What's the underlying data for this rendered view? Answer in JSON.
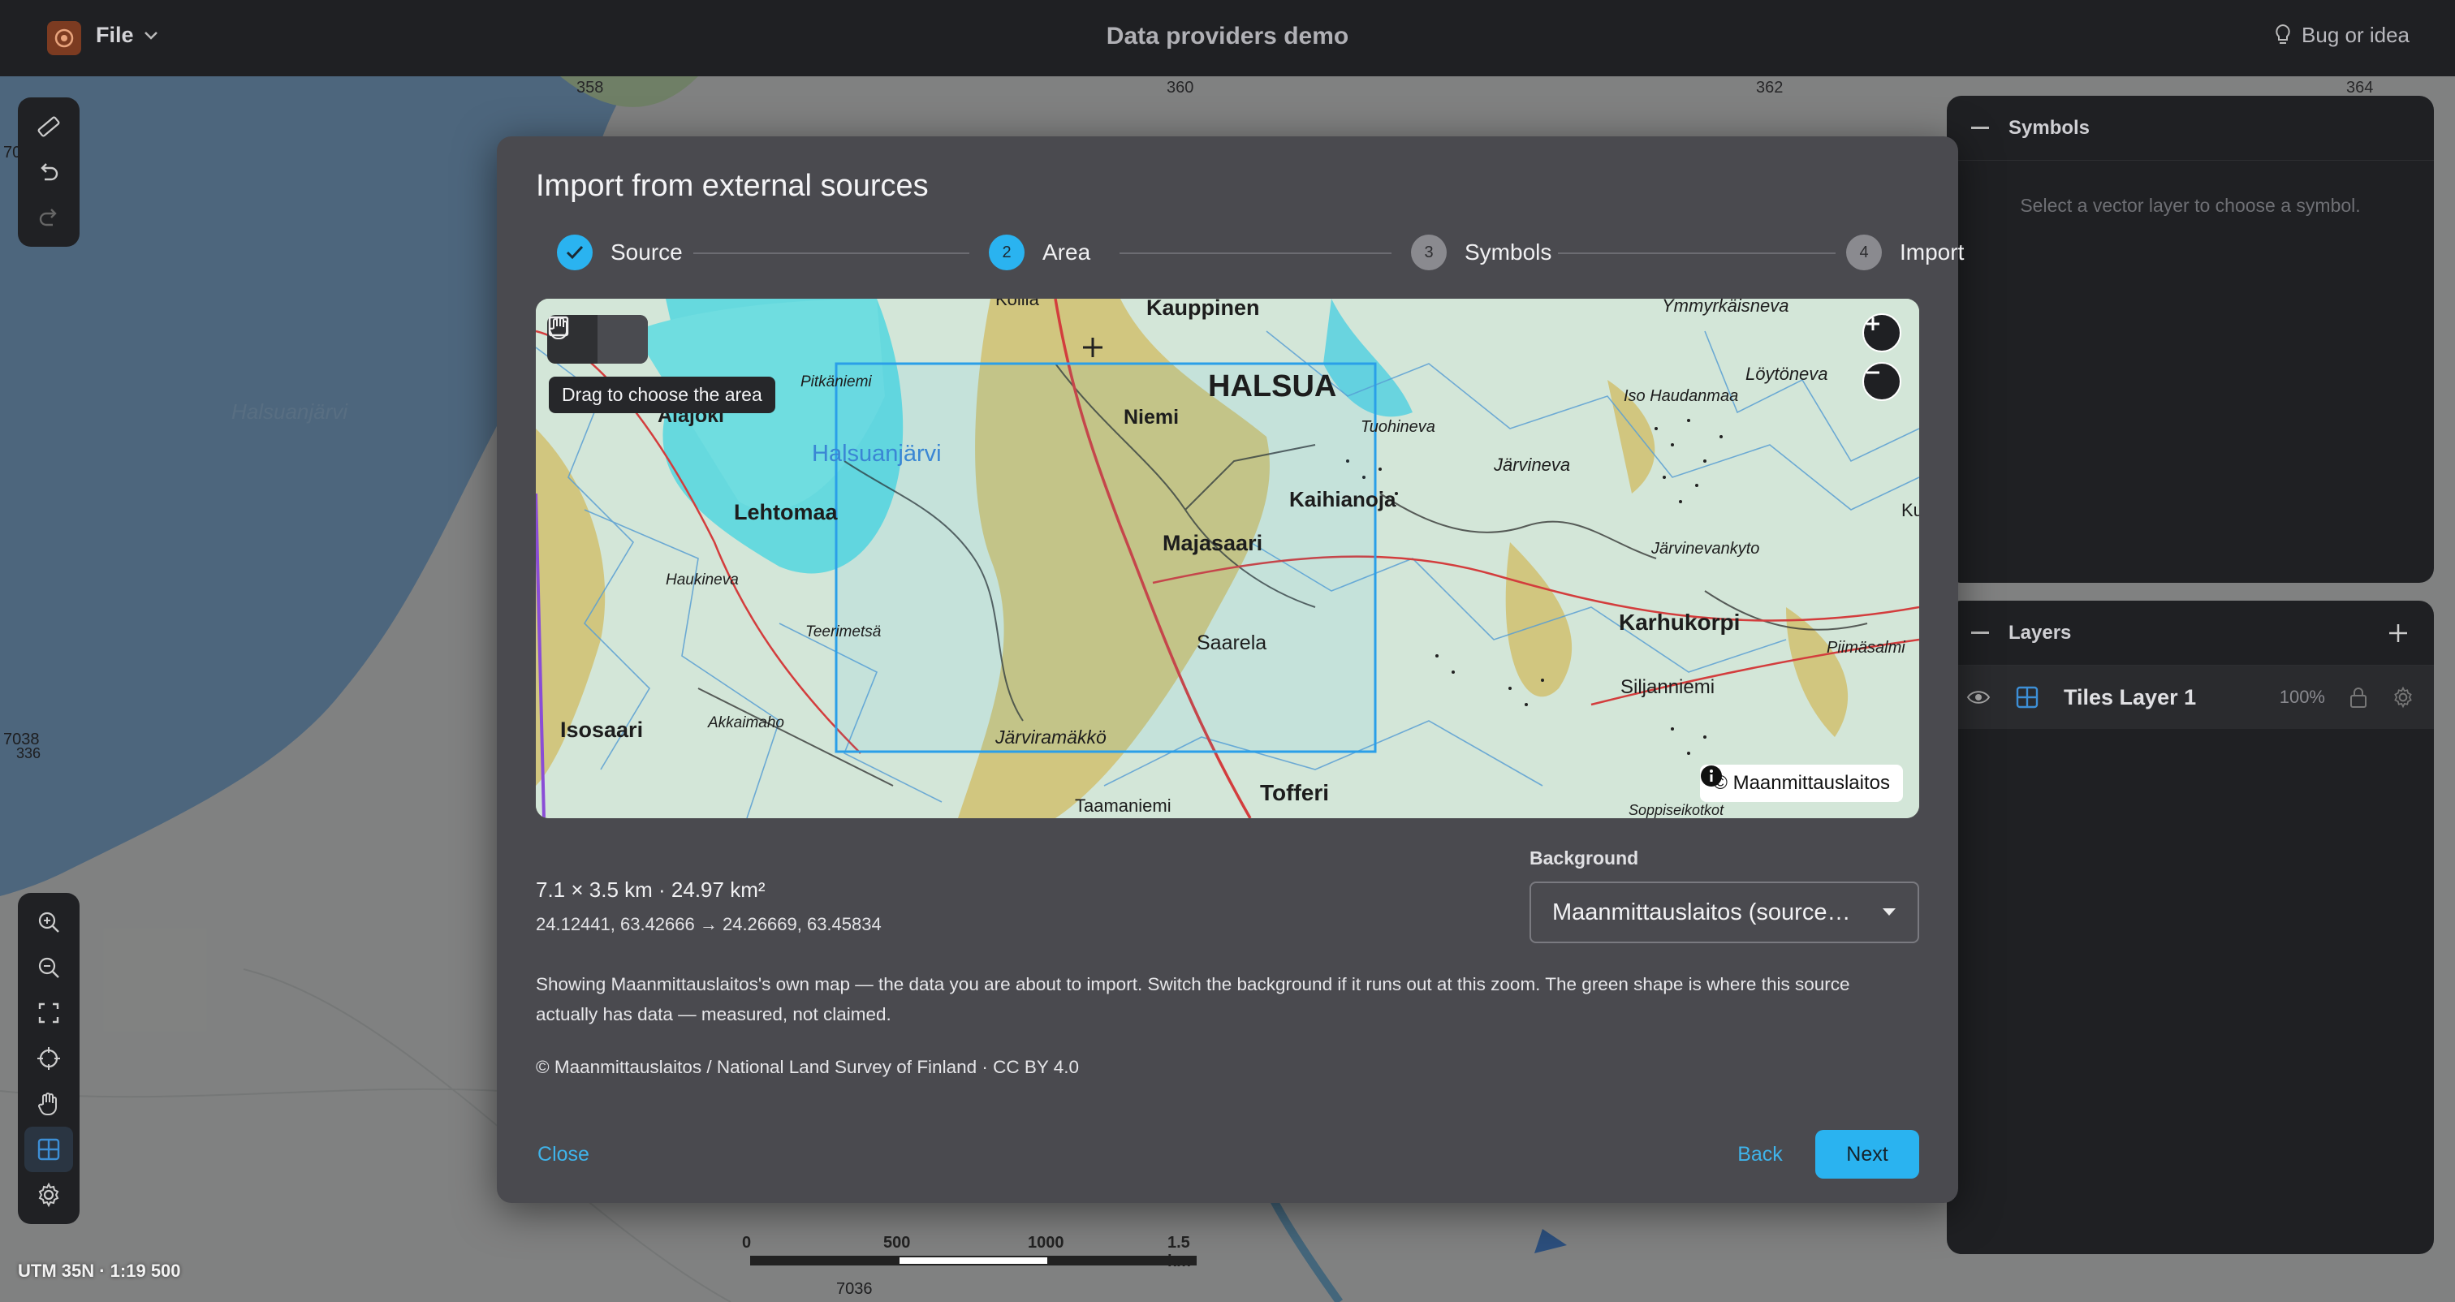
{
  "app": {
    "file_menu": "File",
    "title": "Data providers demo",
    "bug_link": "Bug or idea"
  },
  "background_map": {
    "lake_label": "Halsuanjärvi",
    "grid_labels_top": [
      "358",
      "360",
      "362",
      "364"
    ],
    "grid_label_left": "7038",
    "grid_label_left_small": "336",
    "grid_label_left_top": "70",
    "grid_label_bottom": "7036"
  },
  "status": {
    "projection": "UTM 35N · 1:19 500"
  },
  "scale_bar": {
    "ticks": [
      "0",
      "500",
      "1000",
      "1.5 km"
    ]
  },
  "symbols_panel": {
    "title": "Symbols",
    "placeholder": "Select a vector layer to choose a symbol."
  },
  "layers_panel": {
    "title": "Layers",
    "layers": [
      {
        "name": "Tiles Layer 1",
        "opacity": "100%"
      }
    ]
  },
  "dialog": {
    "title": "Import from external sources",
    "steps": [
      {
        "number": "✓",
        "label": "Source",
        "state": "done"
      },
      {
        "number": "2",
        "label": "Area",
        "state": "active"
      },
      {
        "number": "3",
        "label": "Symbols",
        "state": "pending"
      },
      {
        "number": "4",
        "label": "Import",
        "state": "pending"
      }
    ],
    "preview": {
      "tooltip": "Drag to choose the area",
      "attribution": "© Maanmittauslaitos",
      "place_labels": [
        "Kauppinen",
        "Ymmyrkäisneva",
        "HALSUA",
        "Löytöneva",
        "Iso Haudanmaa",
        "Tuohineva",
        "Niemi",
        "Pitkäniemi",
        "Alajoki",
        "Halsuanjärvi",
        "Lehtomaa",
        "Järvineva",
        "Kaihianoja",
        "Majasaari",
        "Haukineva",
        "Järvinevankyto",
        "Karhukorpi",
        "Piimäsalmi",
        "Saarela",
        "Teerimetsä",
        "Siljanniemi",
        "Isosaari",
        "Akkaimaho",
        "Järviramäkkö",
        "Tofferi",
        "Taamaniemi",
        "Ku",
        "Soppiseikotkot",
        "Kolila"
      ]
    },
    "area_dimensions": "7.1 × 3.5 km · 24.97 km²",
    "area_coords": "24.12441, 63.42666 → 24.26669, 63.45834",
    "background_label": "Background",
    "background_value": "Maanmittauslaitos (source…",
    "description": "Showing Maanmittauslaitos's own map — the data you are about to import. Switch the background if it runs out at this zoom. The green shape is where this source actually has data — measured, not claimed.",
    "credit": "© Maanmittauslaitos / National Land Survey of Finland · CC BY 4.0",
    "close_label": "Close",
    "back_label": "Back",
    "next_label": "Next"
  },
  "colors": {
    "accent": "#2ab3f0",
    "topbar": "#1f2023",
    "dialog": "#4a4a4f",
    "water": "#6fd9dc"
  }
}
